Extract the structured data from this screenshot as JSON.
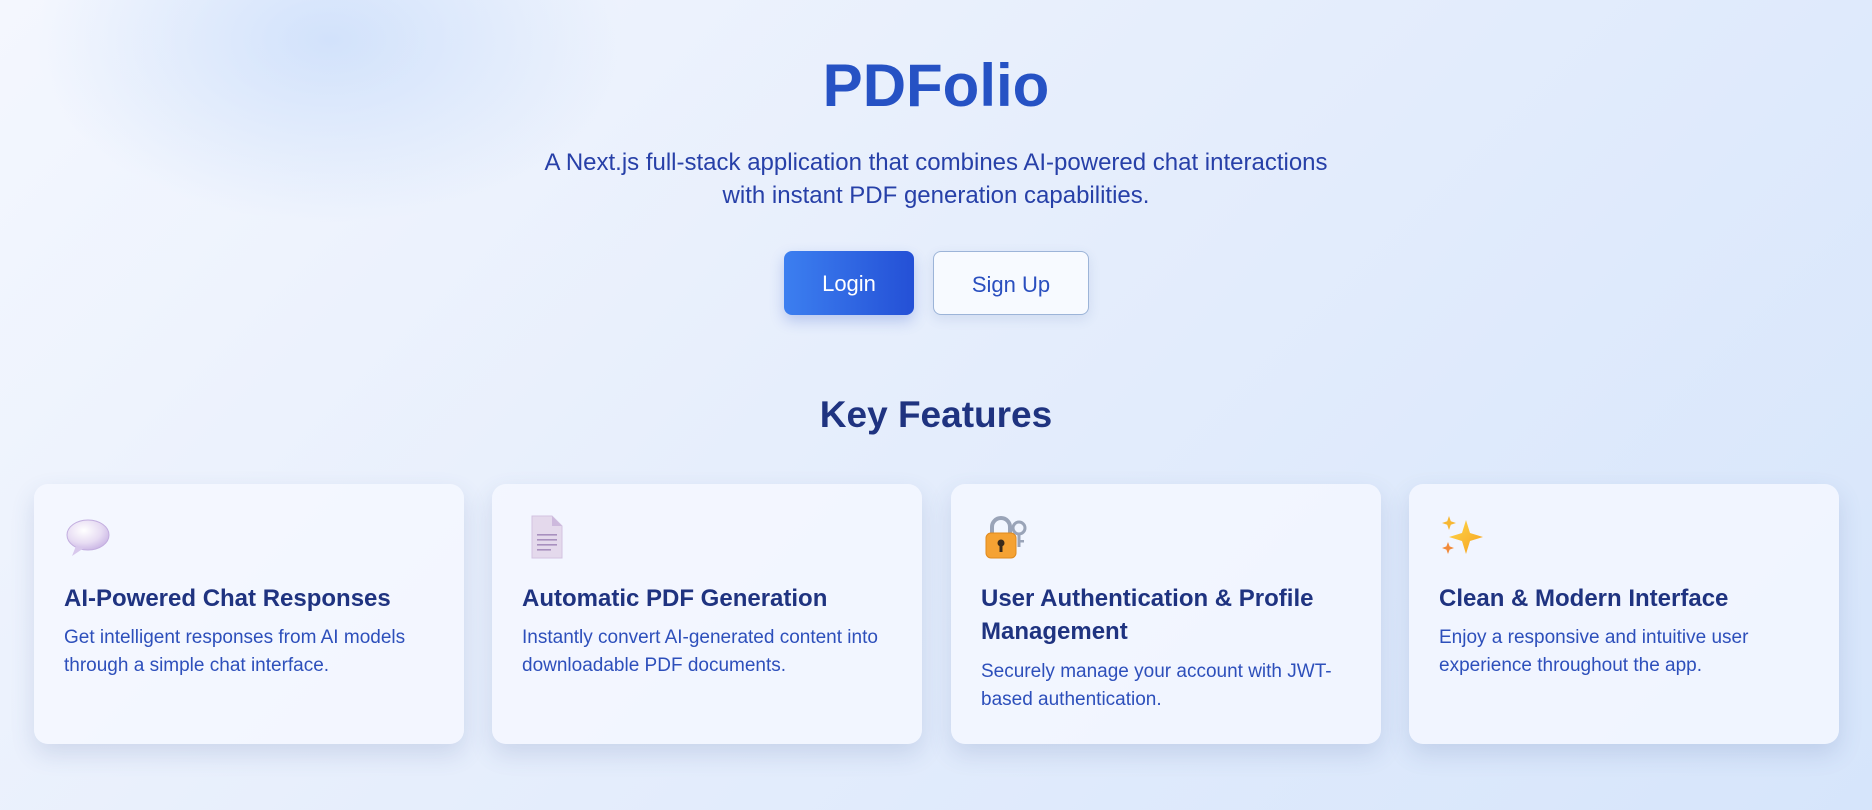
{
  "hero": {
    "title": "PDFolio",
    "subtitle": "A Next.js full-stack application that combines AI-powered chat interactions with instant PDF generation capabilities.",
    "login_label": "Login",
    "signup_label": "Sign Up"
  },
  "features": {
    "title": "Key Features",
    "items": [
      {
        "icon": "speech-bubble-icon",
        "title": "AI-Powered Chat Responses",
        "description": "Get intelligent responses from AI models through a simple chat interface."
      },
      {
        "icon": "document-icon",
        "title": "Automatic PDF Generation",
        "description": "Instantly convert AI-generated content into downloadable PDF documents."
      },
      {
        "icon": "lock-with-key-icon",
        "title": "User Authentication & Profile Management",
        "description": "Securely manage your account with JWT-based authentication."
      },
      {
        "icon": "sparkles-icon",
        "title": "Clean & Modern Interface",
        "description": "Enjoy a responsive and intuitive user experience throughout the app."
      }
    ]
  },
  "colors": {
    "brand": "#2652c4",
    "heading": "#1f3380",
    "body_text": "#2d4fbb",
    "button_primary_start": "#3c7ff0",
    "button_primary_end": "#2450d6"
  }
}
